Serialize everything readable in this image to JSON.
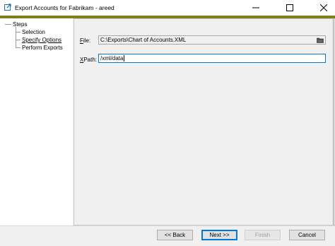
{
  "window": {
    "title": "Export Accounts for Fabrikam  - areed",
    "min_icon": "minimize-icon",
    "max_icon": "maximize-icon",
    "close_icon": "close-icon"
  },
  "colors": {
    "accent_bar": "#807d1c",
    "focus_border": "#0078d7"
  },
  "steps": {
    "root": "Steps",
    "items": [
      "Selection",
      "Specify Options",
      "Perform Exports"
    ],
    "current": "Specify Options"
  },
  "form": {
    "file_label_key": "F",
    "file_label_rest": "ile:",
    "file_value": "C:\\Exports\\Chart of Accounts.XML",
    "xpath_label_key": "X",
    "xpath_label_rest": "Path:",
    "xpath_value": "/xml/data"
  },
  "buttons": {
    "back": "<< Back",
    "next": "Next >>",
    "finish": "Finish",
    "cancel": "Cancel"
  }
}
